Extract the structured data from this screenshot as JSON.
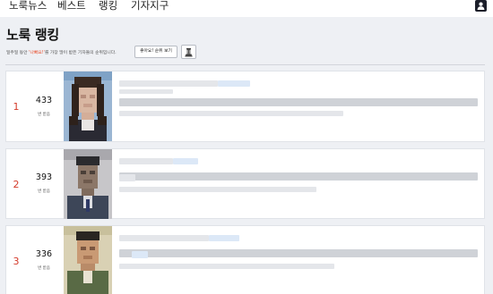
{
  "nav": {
    "items": [
      {
        "label": "노룩뉴스"
      },
      {
        "label": "베스트"
      },
      {
        "label": "랭킹"
      },
      {
        "label": "기자지구"
      }
    ]
  },
  "header": {
    "title": "노룩 랭킹",
    "description_before": "일주일 동안 ",
    "description_highlight": "'나빠요!'",
    "description_after": "를 가장 많이 받은 기자들의 순위입니다.",
    "like_ranking_button": "좋아요! 순위 보기"
  },
  "rankings": [
    {
      "rank": "1",
      "score": "433",
      "unit": "번 받음"
    },
    {
      "rank": "2",
      "score": "393",
      "unit": "번 받음"
    },
    {
      "rank": "3",
      "score": "336",
      "unit": "번 받음"
    }
  ],
  "colors": {
    "accent_red": "#d43a2a",
    "highlight": "#e8431f",
    "background": "#eef0f4"
  }
}
